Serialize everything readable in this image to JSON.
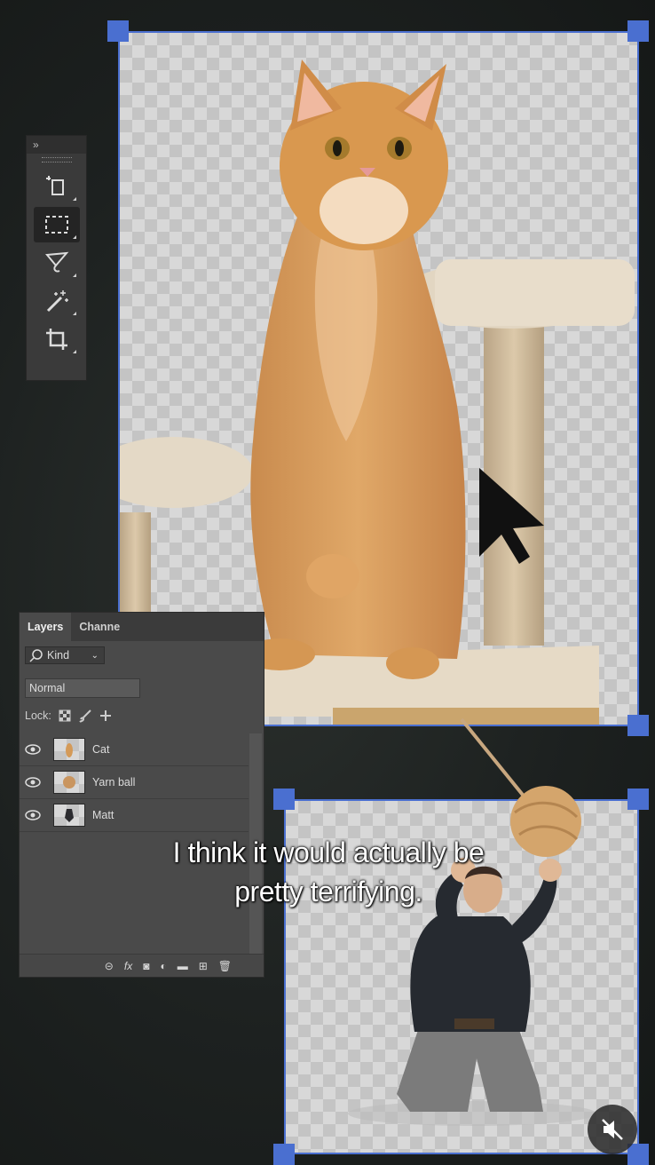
{
  "toolbar": {
    "collapse_label": "»",
    "tools": [
      "artboard-icon",
      "marquee-icon",
      "lasso-icon",
      "magic-wand-icon",
      "crop-icon"
    ],
    "active_tool": "marquee-icon"
  },
  "layers_panel": {
    "tabs": [
      "Layers",
      "Channe"
    ],
    "filter_label": "Kind",
    "blend_mode": "Normal",
    "lock_label": "Lock:",
    "layers": [
      {
        "name": "Cat",
        "visible": true
      },
      {
        "name": "Yarn ball",
        "visible": true
      },
      {
        "name": "Matt",
        "visible": true
      }
    ],
    "footer_fx": "fx"
  },
  "caption": {
    "line1": "I think it would actually be",
    "line2": "pretty terrifying."
  },
  "colors": {
    "selection": "#4a6fd0",
    "panel": "#4a4a4a"
  }
}
